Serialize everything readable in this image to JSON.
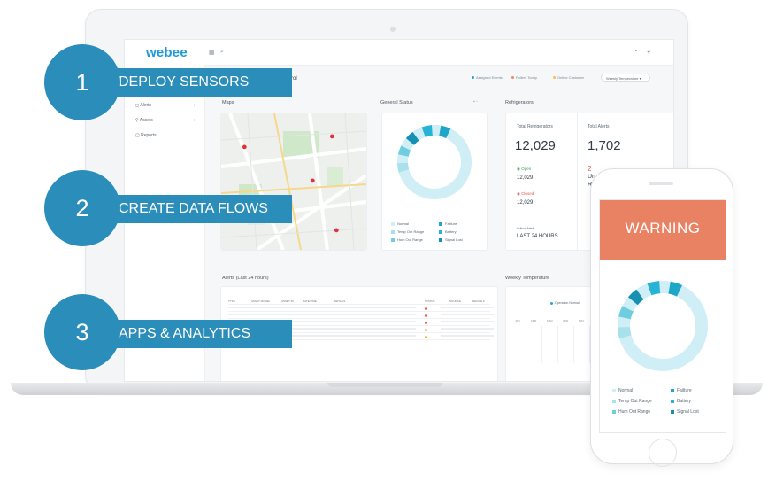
{
  "app": {
    "logo": "webee",
    "header_title_partial": "ntrol",
    "filters": [
      {
        "label": "Assigned Events",
        "color": "#2aa4d6"
      },
      {
        "label": "Pollers Today",
        "color": "#f08a63"
      },
      {
        "label": "Online Customer",
        "color": "#f2c14e"
      }
    ],
    "dropdown_value": "Weekly Temperature",
    "sidebar": {
      "items": [
        {
          "label": "Alerts",
          "icon": "bell-icon"
        },
        {
          "label": "Assets",
          "icon": "link-icon"
        },
        {
          "label": "Reports",
          "icon": "document-icon"
        }
      ]
    },
    "sections": {
      "maps": "Maps",
      "general_status": "General Status",
      "refrigerators": "Refrigerators",
      "alerts": "Alerts (Last 24 hours)",
      "weekly_temperature": "Weekly Temperature"
    },
    "status_legend": [
      {
        "label": "Normal",
        "color": "#cfeef6"
      },
      {
        "label": "Failture",
        "color": "#1ea6c9"
      },
      {
        "label": "Temp Out Range",
        "color": "#a8e0ec"
      },
      {
        "label": "Battery",
        "color": "#27b3d3"
      },
      {
        "label": "Hum Out Range",
        "color": "#6fcde0"
      },
      {
        "label": "Signal Lost",
        "color": "#1691b3"
      }
    ],
    "refrigerators": {
      "total_label": "Total Refrigerators",
      "total_value": "12,029",
      "alerts_label": "Total Alerts",
      "alerts_value": "1,702",
      "open_label": "Open",
      "open_value": "12,029",
      "closed_label": "Closed",
      "closed_value": "12,029",
      "alert_partial_num": "2",
      "alert_partial_text1": "Un",
      "alert_partial_text2": "Ra",
      "critical_label": "Critical Alerts",
      "critical_value": "LAST 24 HOURS"
    },
    "alerts_table": {
      "columns": [
        "TYPE",
        "ASSET MODEL",
        "ASSET ID",
        "DATE/TIME",
        "DETAILS",
        "STATUS",
        "SOURCE",
        "DEVICE #"
      ],
      "rows": [
        {
          "status_color": "#e85a4f"
        },
        {
          "status_color": "#e85a4f"
        },
        {
          "status_color": "#e85a4f"
        },
        {
          "status_color": "#f2b33d"
        },
        {
          "status_color": "#f2b33d"
        }
      ]
    },
    "weekly": {
      "legend": "Operation Normal",
      "months": [
        "JAN",
        "FEB",
        "MAR",
        "APR",
        "MAY"
      ]
    }
  },
  "steps": [
    {
      "number": "1",
      "label": "DEPLOY SENSORS"
    },
    {
      "number": "2",
      "label": "CREATE DATA FLOWS"
    },
    {
      "number": "3",
      "label": "APPS & ANALYTICS"
    }
  ],
  "phone": {
    "warning": "WARNING",
    "legend": [
      {
        "label": "Normal",
        "color": "#cfeef6"
      },
      {
        "label": "Failture",
        "color": "#1ea6c9"
      },
      {
        "label": "Temp Out Range",
        "color": "#a8e0ec"
      },
      {
        "label": "Battery",
        "color": "#27b3d3"
      },
      {
        "label": "Hum Out Range",
        "color": "#6fcde0"
      },
      {
        "label": "Signal Lost",
        "color": "#1691b3"
      }
    ]
  },
  "colors": {
    "accent": "#2a8dba",
    "warning": "#e98263",
    "map_pin": "#e0303a"
  }
}
